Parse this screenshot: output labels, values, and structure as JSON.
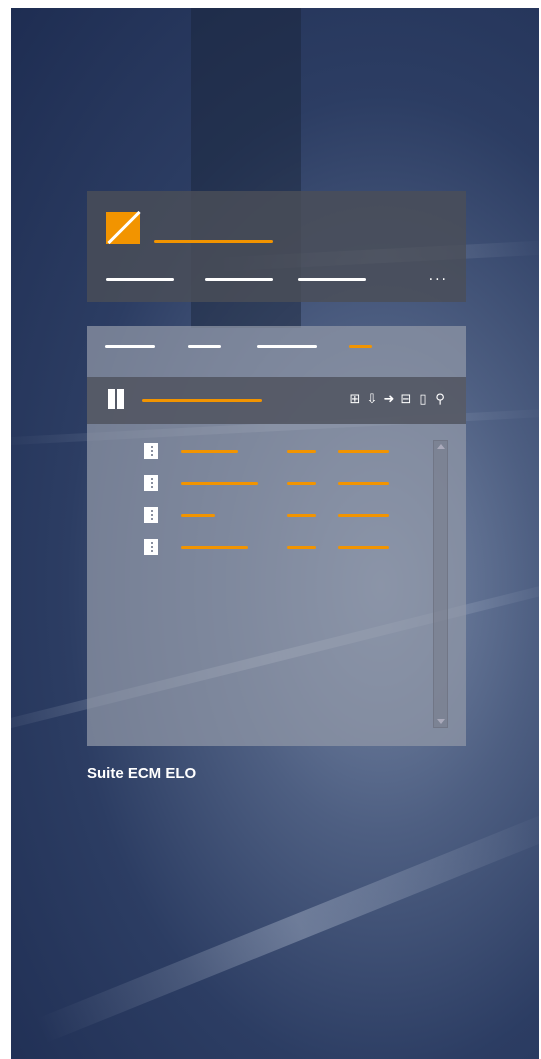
{
  "caption": "Suite ECM ELO",
  "colors": {
    "accent": "#f29400",
    "header_bg": "#4b4e58",
    "toolbar_bg": "#50545f",
    "panel_bg": "#9198a8"
  },
  "header": {
    "logo": "elo-logo-icon",
    "more": "···"
  },
  "toolbar": {
    "left_icon": "binder-icon",
    "icons": [
      "folder-add-icon",
      "download-icon",
      "arrow-link-icon",
      "tree-structure-icon",
      "document-icon",
      "search-icon"
    ]
  },
  "list": {
    "row_icon": "document-list-icon"
  }
}
